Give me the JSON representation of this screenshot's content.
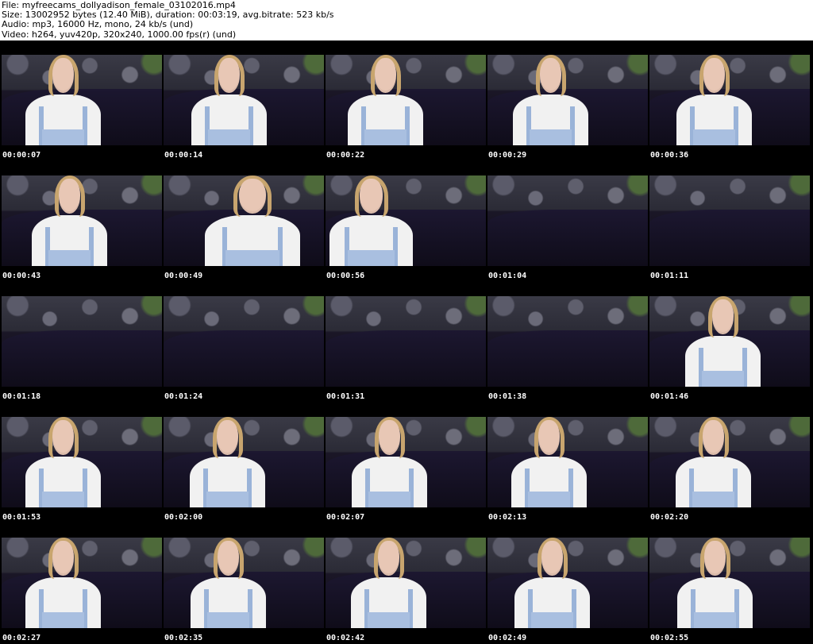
{
  "header": {
    "file_line": "File: myfreecams_dollyadison_female_03102016.mp4",
    "size_line": "Size: 13002952 bytes (12.40 MiB), duration: 00:03:19, avg.bitrate: 523 kb/s",
    "audio_line": "Audio: mp3, 16000 Hz, mono, 24 kb/s (und)",
    "video_line": "Video: h264, yuv420p, 320x240, 1000.00 fps(r) (und)"
  },
  "thumbnails": [
    {
      "time": "00:00:07",
      "person": "present"
    },
    {
      "time": "00:00:14",
      "person": "present"
    },
    {
      "time": "00:00:22",
      "person": "present"
    },
    {
      "time": "00:00:29",
      "person": "present"
    },
    {
      "time": "00:00:36",
      "person": "present"
    },
    {
      "time": "00:00:43",
      "person": "present"
    },
    {
      "time": "00:00:49",
      "person": "present"
    },
    {
      "time": "00:00:56",
      "person": "present"
    },
    {
      "time": "00:01:04",
      "person": "absent"
    },
    {
      "time": "00:01:11",
      "person": "absent"
    },
    {
      "time": "00:01:18",
      "person": "absent"
    },
    {
      "time": "00:01:24",
      "person": "absent"
    },
    {
      "time": "00:01:31",
      "person": "absent"
    },
    {
      "time": "00:01:38",
      "person": "absent"
    },
    {
      "time": "00:01:46",
      "person": "present"
    },
    {
      "time": "00:01:53",
      "person": "present"
    },
    {
      "time": "00:02:00",
      "person": "present"
    },
    {
      "time": "00:02:07",
      "person": "present"
    },
    {
      "time": "00:02:13",
      "person": "present"
    },
    {
      "time": "00:02:20",
      "person": "present"
    },
    {
      "time": "00:02:27",
      "person": "present"
    },
    {
      "time": "00:02:35",
      "person": "present"
    },
    {
      "time": "00:02:42",
      "person": "present"
    },
    {
      "time": "00:02:49",
      "person": "present"
    },
    {
      "time": "00:02:55",
      "person": "present"
    }
  ]
}
